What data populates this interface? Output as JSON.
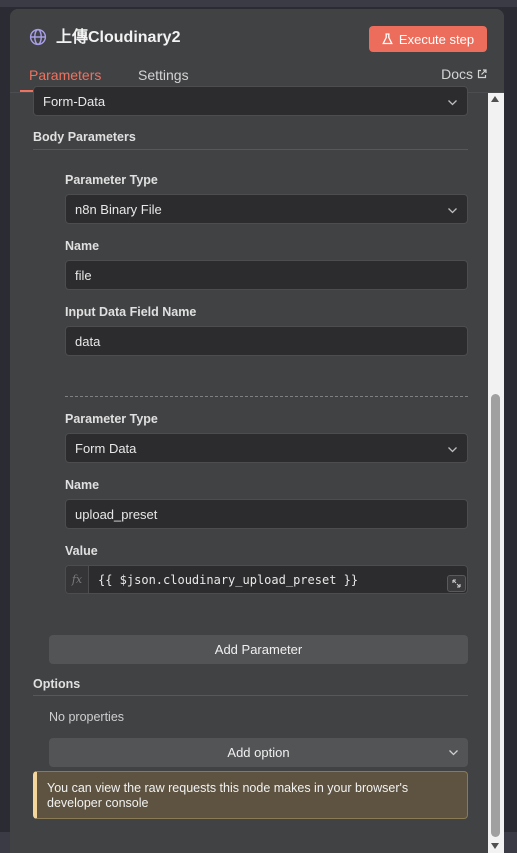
{
  "node": {
    "title": "上傳Cloudinary2",
    "execute_label": "Execute step",
    "icon": "globe-icon"
  },
  "tabs": {
    "parameters": "Parameters",
    "settings": "Settings",
    "docs": "Docs"
  },
  "body": {
    "content_type_value": "Form-Data",
    "section_title": "Body Parameters",
    "params": [
      {
        "type_label": "Parameter Type",
        "type_value": "n8n Binary File",
        "name_label": "Name",
        "name_value": "file",
        "field_label": "Input Data Field Name",
        "field_value": "data"
      },
      {
        "type_label": "Parameter Type",
        "type_value": "Form Data",
        "name_label": "Name",
        "name_value": "upload_preset",
        "value_label": "Value",
        "value_expr": "{{ $json.cloudinary_upload_preset }}",
        "fx": "fx"
      }
    ],
    "add_parameter": "Add Parameter"
  },
  "options": {
    "title": "Options",
    "empty_text": "No properties",
    "add_option": "Add option"
  },
  "notice": "You can view the raw requests this node makes in your browser's developer console",
  "colors": {
    "accent": "#ee7260",
    "execute_bg": "#ec6d5b",
    "panel_bg": "#414244",
    "notice_border": "#f4d59b"
  }
}
